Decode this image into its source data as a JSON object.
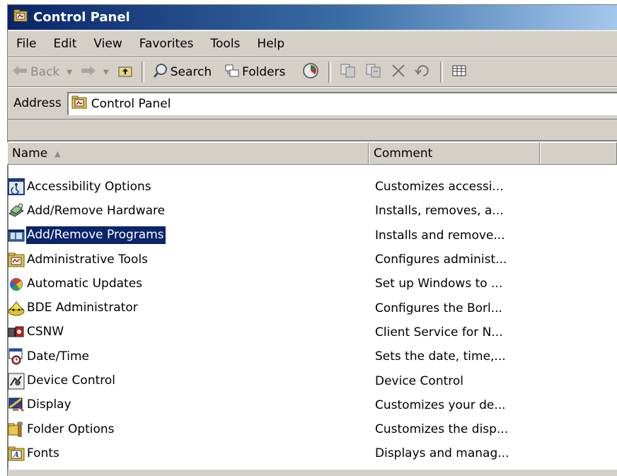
{
  "window": {
    "title": "Control Panel"
  },
  "menu": [
    {
      "label": "File"
    },
    {
      "label": "Edit"
    },
    {
      "label": "View"
    },
    {
      "label": "Favorites"
    },
    {
      "label": "Tools"
    },
    {
      "label": "Help"
    }
  ],
  "toolbar": {
    "back": "Back",
    "search": "Search",
    "folders": "Folders"
  },
  "address": {
    "label": "Address",
    "value": "Control Panel"
  },
  "columns": {
    "name": "Name",
    "comment": "Comment"
  },
  "items": [
    {
      "name": "Accessibility Options",
      "comment": "Customizes accessi...",
      "icon": "accessibility-icon",
      "selected": false
    },
    {
      "name": "Add/Remove Hardware",
      "comment": "Installs, removes, a...",
      "icon": "hardware-icon",
      "selected": false
    },
    {
      "name": "Add/Remove Programs",
      "comment": "Installs and remove...",
      "icon": "programs-icon",
      "selected": true
    },
    {
      "name": "Administrative Tools",
      "comment": "Configures administ...",
      "icon": "admin-tools-icon",
      "selected": false
    },
    {
      "name": "Automatic Updates",
      "comment": "Set up Windows to ...",
      "icon": "updates-icon",
      "selected": false
    },
    {
      "name": "BDE Administrator",
      "comment": "Configures the Borl...",
      "icon": "bde-icon",
      "selected": false
    },
    {
      "name": "CSNW",
      "comment": "Client Service for N...",
      "icon": "csnw-icon",
      "selected": false
    },
    {
      "name": "Date/Time",
      "comment": "Sets the date, time,...",
      "icon": "datetime-icon",
      "selected": false
    },
    {
      "name": "Device Control",
      "comment": "Device Control",
      "icon": "device-control-icon",
      "selected": false
    },
    {
      "name": "Display",
      "comment": "Customizes your de...",
      "icon": "display-icon",
      "selected": false
    },
    {
      "name": "Folder Options",
      "comment": "Customizes the disp...",
      "icon": "folder-options-icon",
      "selected": false
    },
    {
      "name": "Fonts",
      "comment": "Displays and manag...",
      "icon": "fonts-icon",
      "selected": false
    }
  ]
}
